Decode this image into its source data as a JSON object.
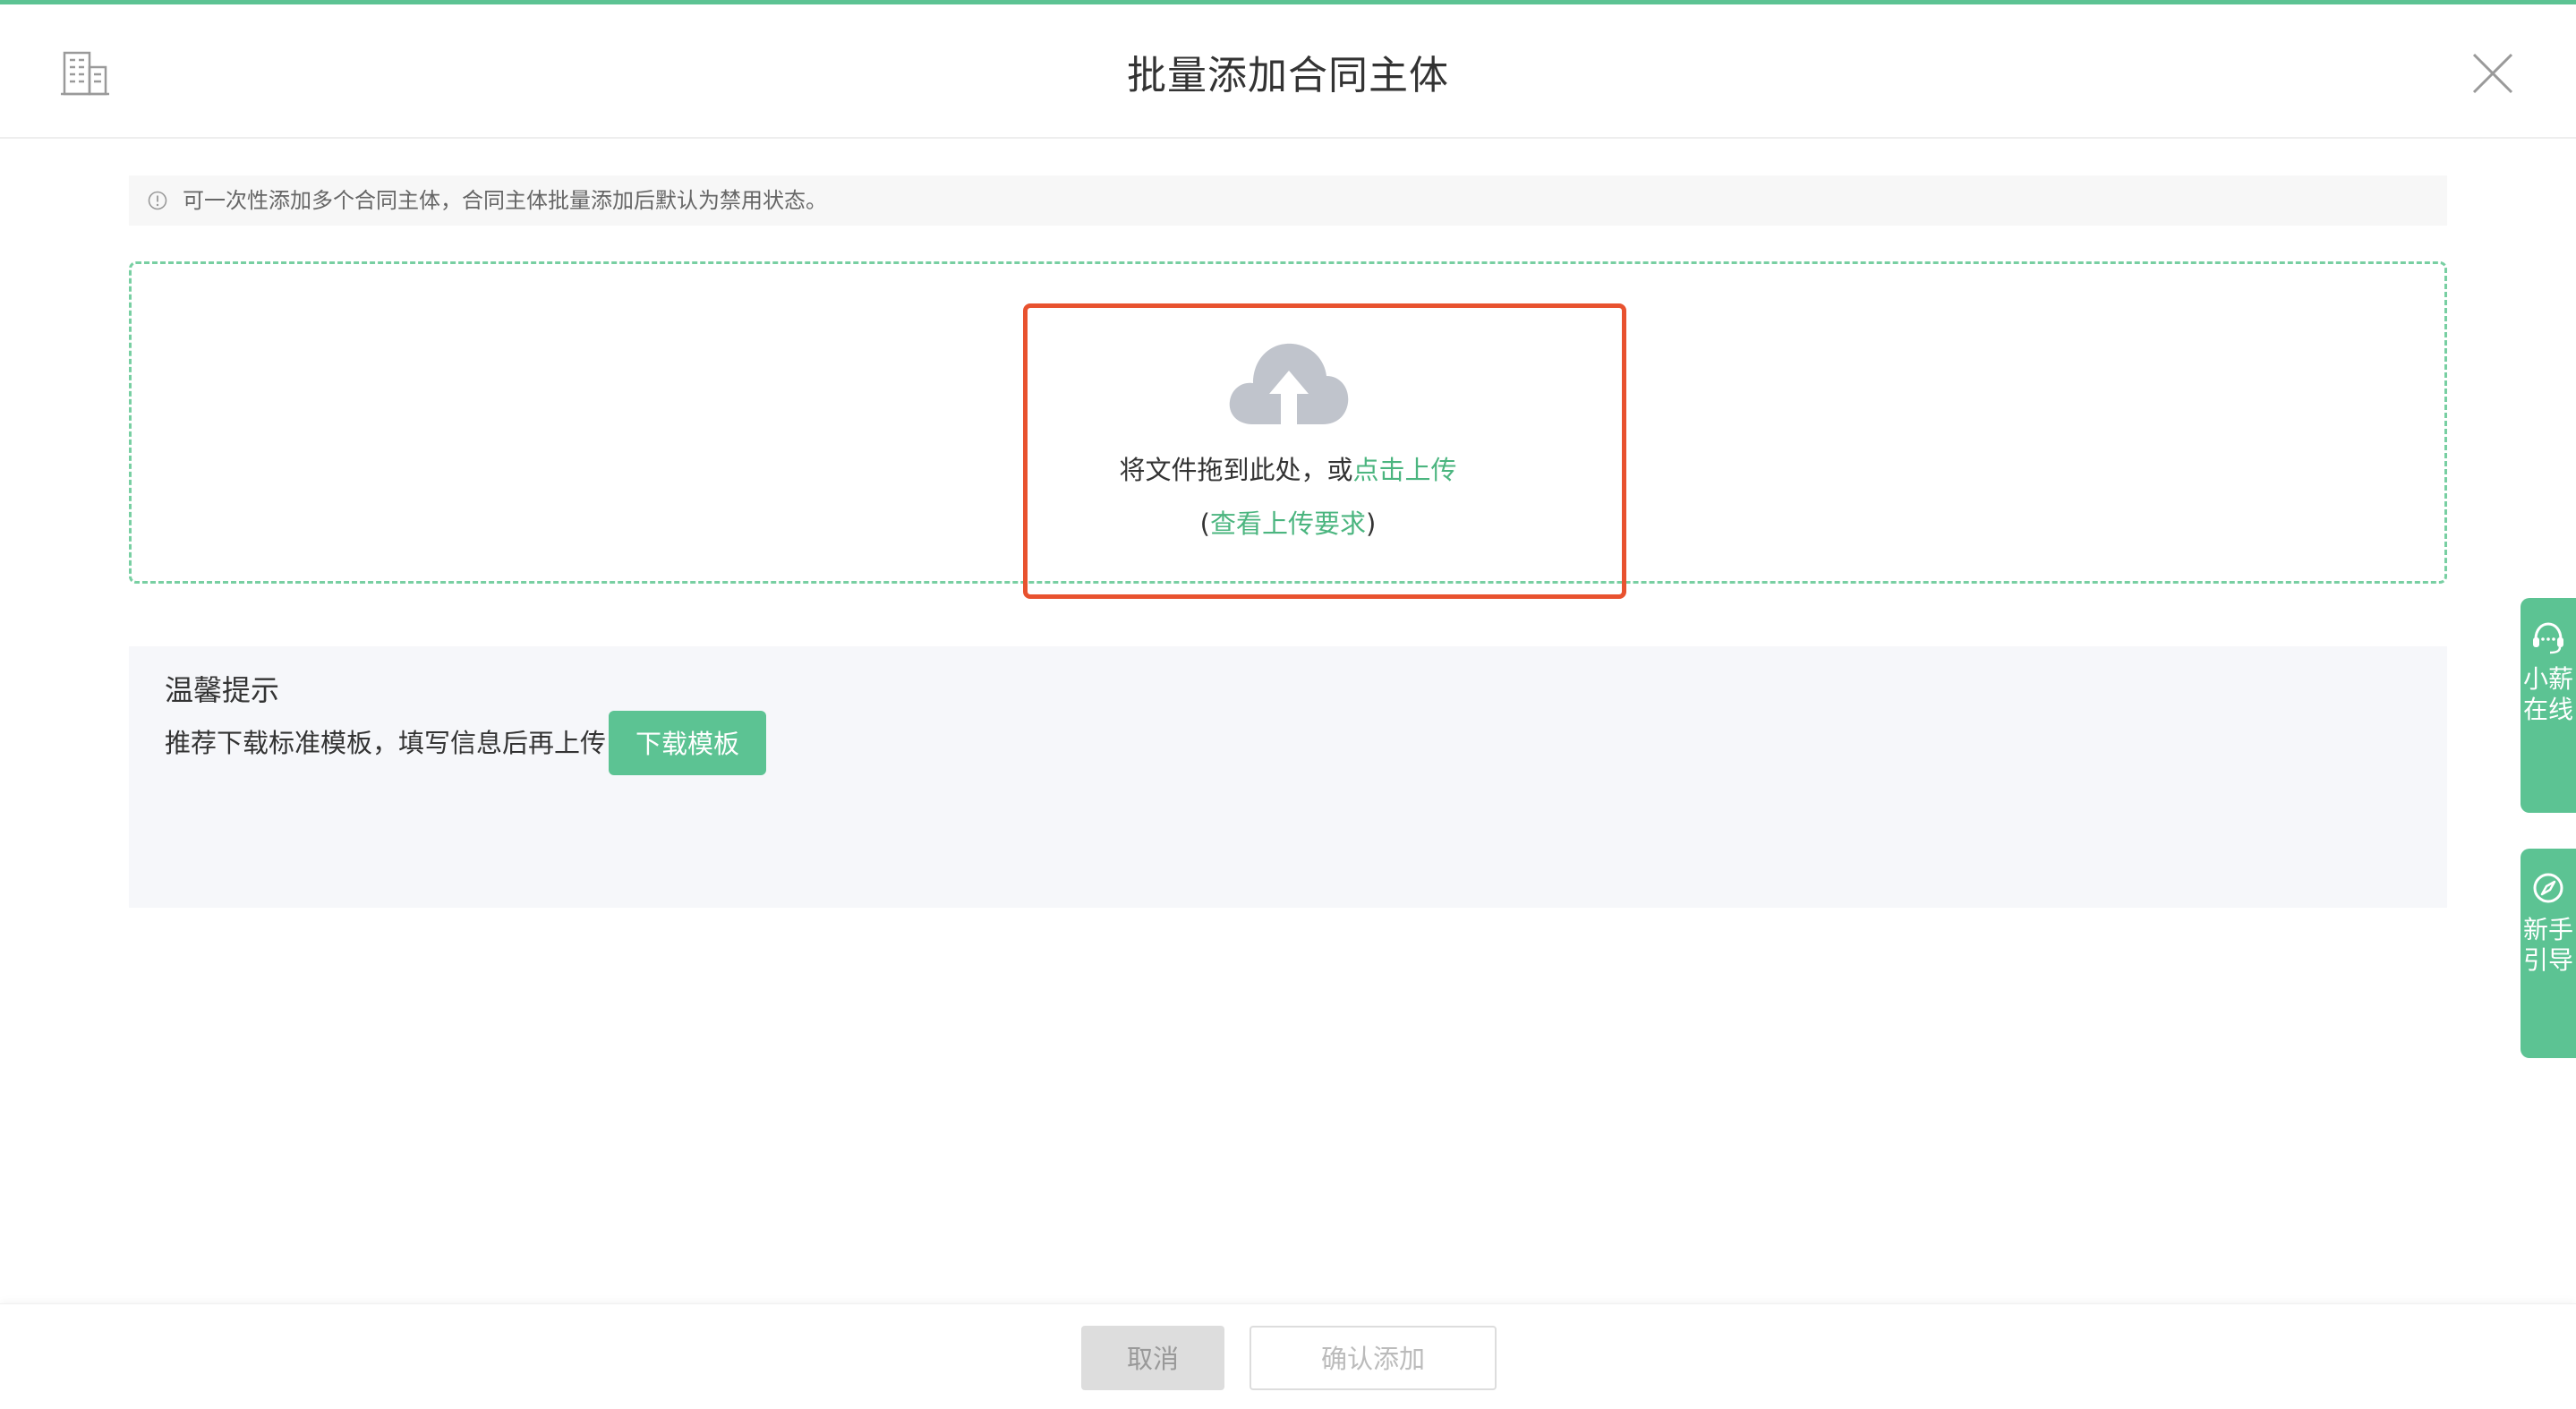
{
  "dialog": {
    "title": "批量添加合同主体",
    "building_icon": "building-icon",
    "close_icon": "close-icon"
  },
  "notice": {
    "icon": "info-circle-icon",
    "text": "可一次性添加多个合同主体，合同主体批量添加后默认为禁用状态。"
  },
  "upload": {
    "icon": "cloud-upload-icon",
    "drop_text": "将文件拖到此处，或",
    "click_link": "点击上传",
    "req_open": "(",
    "req_link": "查看上传要求",
    "req_close": ")"
  },
  "tips": {
    "title": "温馨提示",
    "desc": "推荐下载标准模板，填写信息后再上传",
    "download_label": "下载模板"
  },
  "side": {
    "chat_label": "小薪在线",
    "chat_icon": "headset-icon",
    "guide_label": "新手引导",
    "guide_icon": "compass-icon"
  },
  "footer": {
    "cancel_label": "取消",
    "confirm_label": "确认添加"
  },
  "colors": {
    "accent": "#5cc393",
    "link": "#4bb57f",
    "highlight": "#e8522f"
  }
}
